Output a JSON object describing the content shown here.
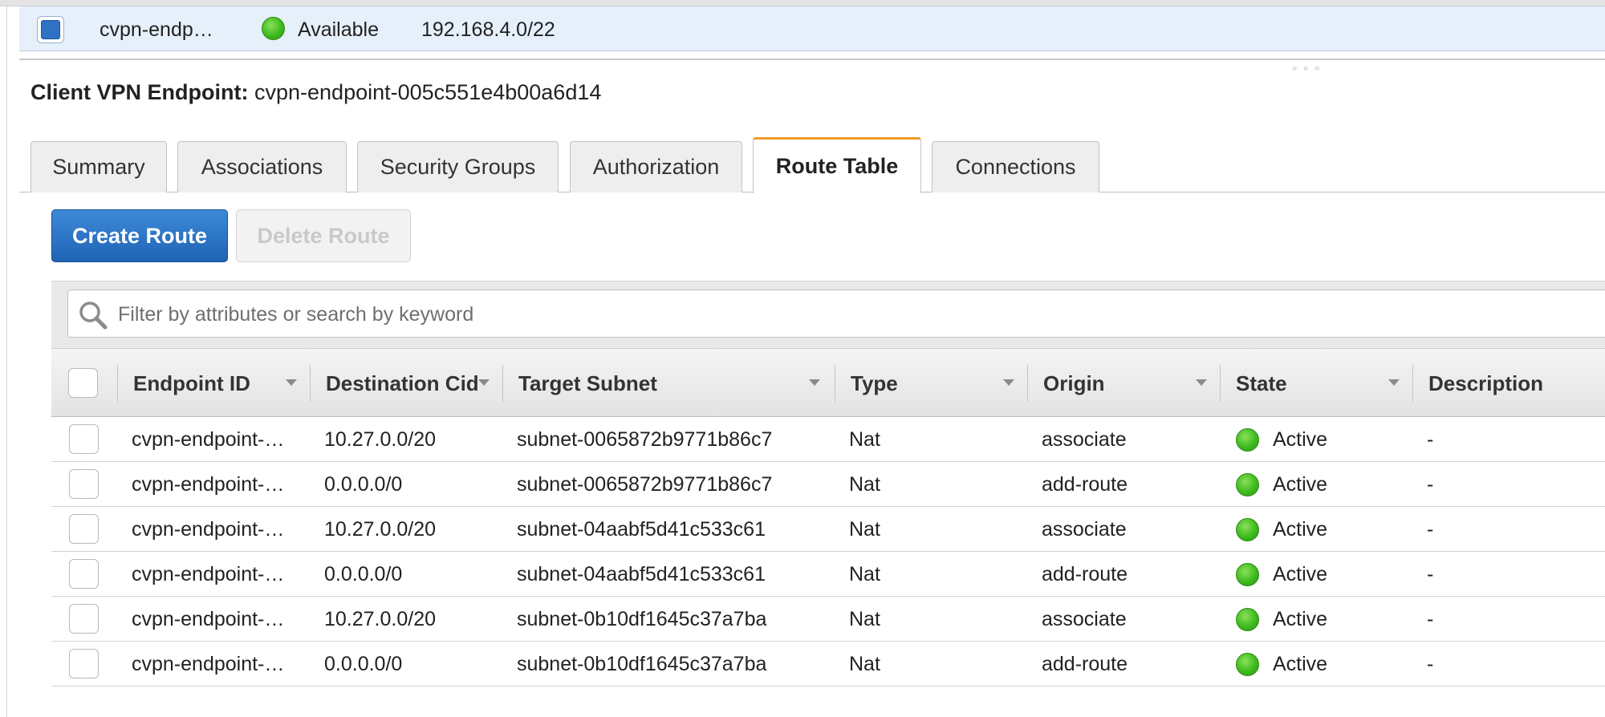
{
  "selected_endpoint": {
    "name": "cvpn-endp…",
    "status": "Available",
    "cidr": "192.168.4.0/22",
    "checked": true
  },
  "details": {
    "title_label": "Client VPN Endpoint:",
    "endpoint_id": "cvpn-endpoint-005c551e4b00a6d14"
  },
  "tabs": [
    {
      "label": "Summary",
      "active": false
    },
    {
      "label": "Associations",
      "active": false
    },
    {
      "label": "Security Groups",
      "active": false
    },
    {
      "label": "Authorization",
      "active": false
    },
    {
      "label": "Route Table",
      "active": true
    },
    {
      "label": "Connections",
      "active": false
    }
  ],
  "actions": {
    "create_route": "Create Route",
    "delete_route": "Delete Route"
  },
  "filter": {
    "placeholder": "Filter by attributes or search by keyword",
    "value": ""
  },
  "table": {
    "columns": [
      "Endpoint ID",
      "Destination Cid",
      "Target Subnet",
      "Type",
      "Origin",
      "State",
      "Description"
    ],
    "rows": [
      {
        "endpoint": "cvpn-endpoint-…",
        "destination": "10.27.0.0/20",
        "subnet": "subnet-0065872b9771b86c7",
        "type": "Nat",
        "origin": "associate",
        "state": "Active",
        "description": "-"
      },
      {
        "endpoint": "cvpn-endpoint-…",
        "destination": "0.0.0.0/0",
        "subnet": "subnet-0065872b9771b86c7",
        "type": "Nat",
        "origin": "add-route",
        "state": "Active",
        "description": "-"
      },
      {
        "endpoint": "cvpn-endpoint-…",
        "destination": "10.27.0.0/20",
        "subnet": "subnet-04aabf5d41c533c61",
        "type": "Nat",
        "origin": "associate",
        "state": "Active",
        "description": "-"
      },
      {
        "endpoint": "cvpn-endpoint-…",
        "destination": "0.0.0.0/0",
        "subnet": "subnet-04aabf5d41c533c61",
        "type": "Nat",
        "origin": "add-route",
        "state": "Active",
        "description": "-"
      },
      {
        "endpoint": "cvpn-endpoint-…",
        "destination": "10.27.0.0/20",
        "subnet": "subnet-0b10df1645c37a7ba",
        "type": "Nat",
        "origin": "associate",
        "state": "Active",
        "description": "-"
      },
      {
        "endpoint": "cvpn-endpoint-…",
        "destination": "0.0.0.0/0",
        "subnet": "subnet-0b10df1645c37a7ba",
        "type": "Nat",
        "origin": "add-route",
        "state": "Active",
        "description": "-"
      }
    ]
  },
  "colors": {
    "primary": "#1f63b5",
    "active_tab_accent": "#f39a2a",
    "status_green": "#3dbb1e",
    "selected_row_bg": "#e6f0fb"
  },
  "icons": {
    "search": "search-icon",
    "sort": "sort-caret-icon",
    "status": "status-dot-icon"
  }
}
